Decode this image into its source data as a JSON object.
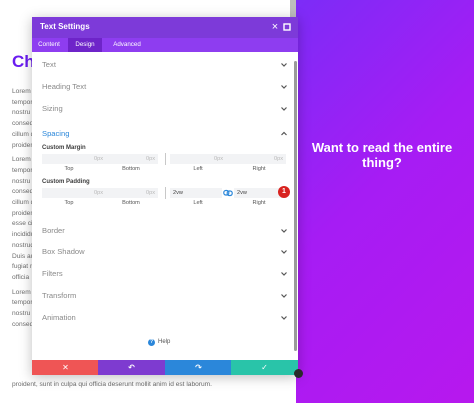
{
  "page": {
    "heading": "Cha",
    "lines": [
      "Lorem",
      "tempor",
      "nostru",
      "consequ",
      "cillum d",
      "proident",
      "Lorem",
      "tempor",
      "nostru",
      "consequ",
      "cillum d",
      "proident",
      "esse cil",
      "incididu",
      "nostrud",
      "Duis au",
      "fugiat n",
      "officia",
      "Lorem",
      "tempor",
      "nostru",
      "consequ"
    ],
    "bottom_line": "proident, sunt in culpa qui officia deserunt mollit anim id est laborum.",
    "cta": "Want to read the entire thing?"
  },
  "modal": {
    "title": "Text Settings",
    "close_glyph": "×",
    "tabs": [
      {
        "label": "Content",
        "active": false
      },
      {
        "label": "Design",
        "active": true
      },
      {
        "label": "Advanced",
        "active": false
      }
    ],
    "sections_top": [
      "Text",
      "Heading Text",
      "Sizing"
    ],
    "spacing": {
      "label": "Spacing",
      "custom_margin_label": "Custom Margin",
      "margin_placeholders": [
        "0px",
        "0px",
        "0px",
        "0px"
      ],
      "custom_padding_label": "Custom Padding",
      "padding_values": [
        "0px",
        "0px",
        "2vw",
        "2vw"
      ],
      "captions": [
        "Top",
        "Bottom",
        "Left",
        "Right"
      ],
      "marker": "1"
    },
    "sections_bottom": [
      "Border",
      "Box Shadow",
      "Filters",
      "Transform",
      "Animation"
    ],
    "help_label": "Help",
    "footer_buttons": [
      {
        "name": "discard",
        "glyph": "✕",
        "color": "#ef5555"
      },
      {
        "name": "undo",
        "glyph": "↶",
        "color": "#7e3bd0"
      },
      {
        "name": "redo",
        "glyph": "↷",
        "color": "#2b87da"
      },
      {
        "name": "save",
        "glyph": "✓",
        "color": "#29c4a9"
      }
    ]
  },
  "colors": {
    "header": "#7d3ad9",
    "tabs": "#8e3df0",
    "accent_blue": "#2b87da",
    "gradient_start": "#7c2cf7",
    "gradient_end": "#b718ee"
  }
}
